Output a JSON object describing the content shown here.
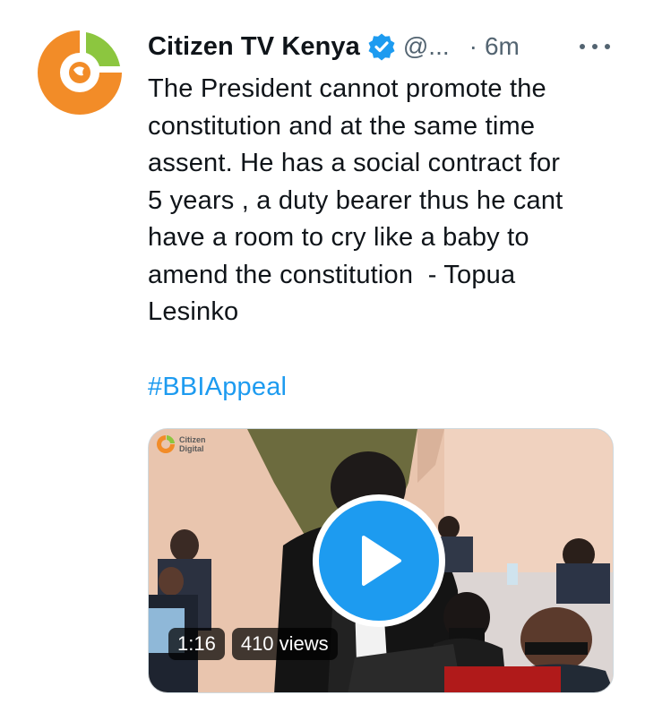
{
  "author": {
    "display_name": "Citizen TV Kenya",
    "handle": "@...",
    "separator": "·",
    "time": "6m",
    "avatar_icon": "citizen-tv-logo",
    "verified_icon": "verified-badge-icon"
  },
  "tweet": {
    "lines": [
      "The President cannot promote the",
      "constitution and at the same time",
      "assent. He has a social contract for",
      "5 years , a duty bearer thus he cant",
      "have a room to cry like a baby to",
      "amend the constitution  - Topua",
      "Lesinko"
    ],
    "hashtag": "#BBIAppeal"
  },
  "video": {
    "watermark_line1": "Citizen",
    "watermark_line2": "Digital",
    "duration": "1:16",
    "views": "410 views",
    "play_icon": "play-icon"
  },
  "colors": {
    "accent": "#1d9bf0",
    "logo_orange": "#f28c28",
    "logo_green": "#8cc63f",
    "secondary_text": "#536471"
  }
}
